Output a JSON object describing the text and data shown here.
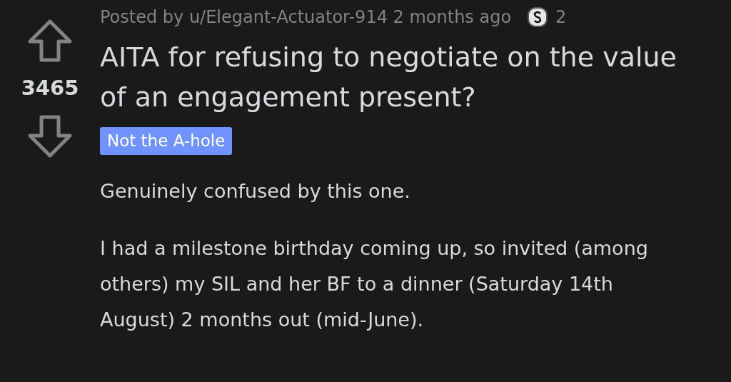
{
  "post": {
    "meta": "Posted by u/Elegant-Actuator-914 2 months ago",
    "award_count": "2",
    "score": "3465",
    "title": "AITA for refusing to negotiate on the value of an engagement present?",
    "flair": {
      "label": "Not the A-hole",
      "color": "#7193ff"
    },
    "body": [
      "Genuinely confused by this one.",
      "I had a milestone birthday coming up, so invited (among others) my SIL and her BF to a dinner (Saturday 14th August) 2 months out (mid-June)."
    ]
  }
}
